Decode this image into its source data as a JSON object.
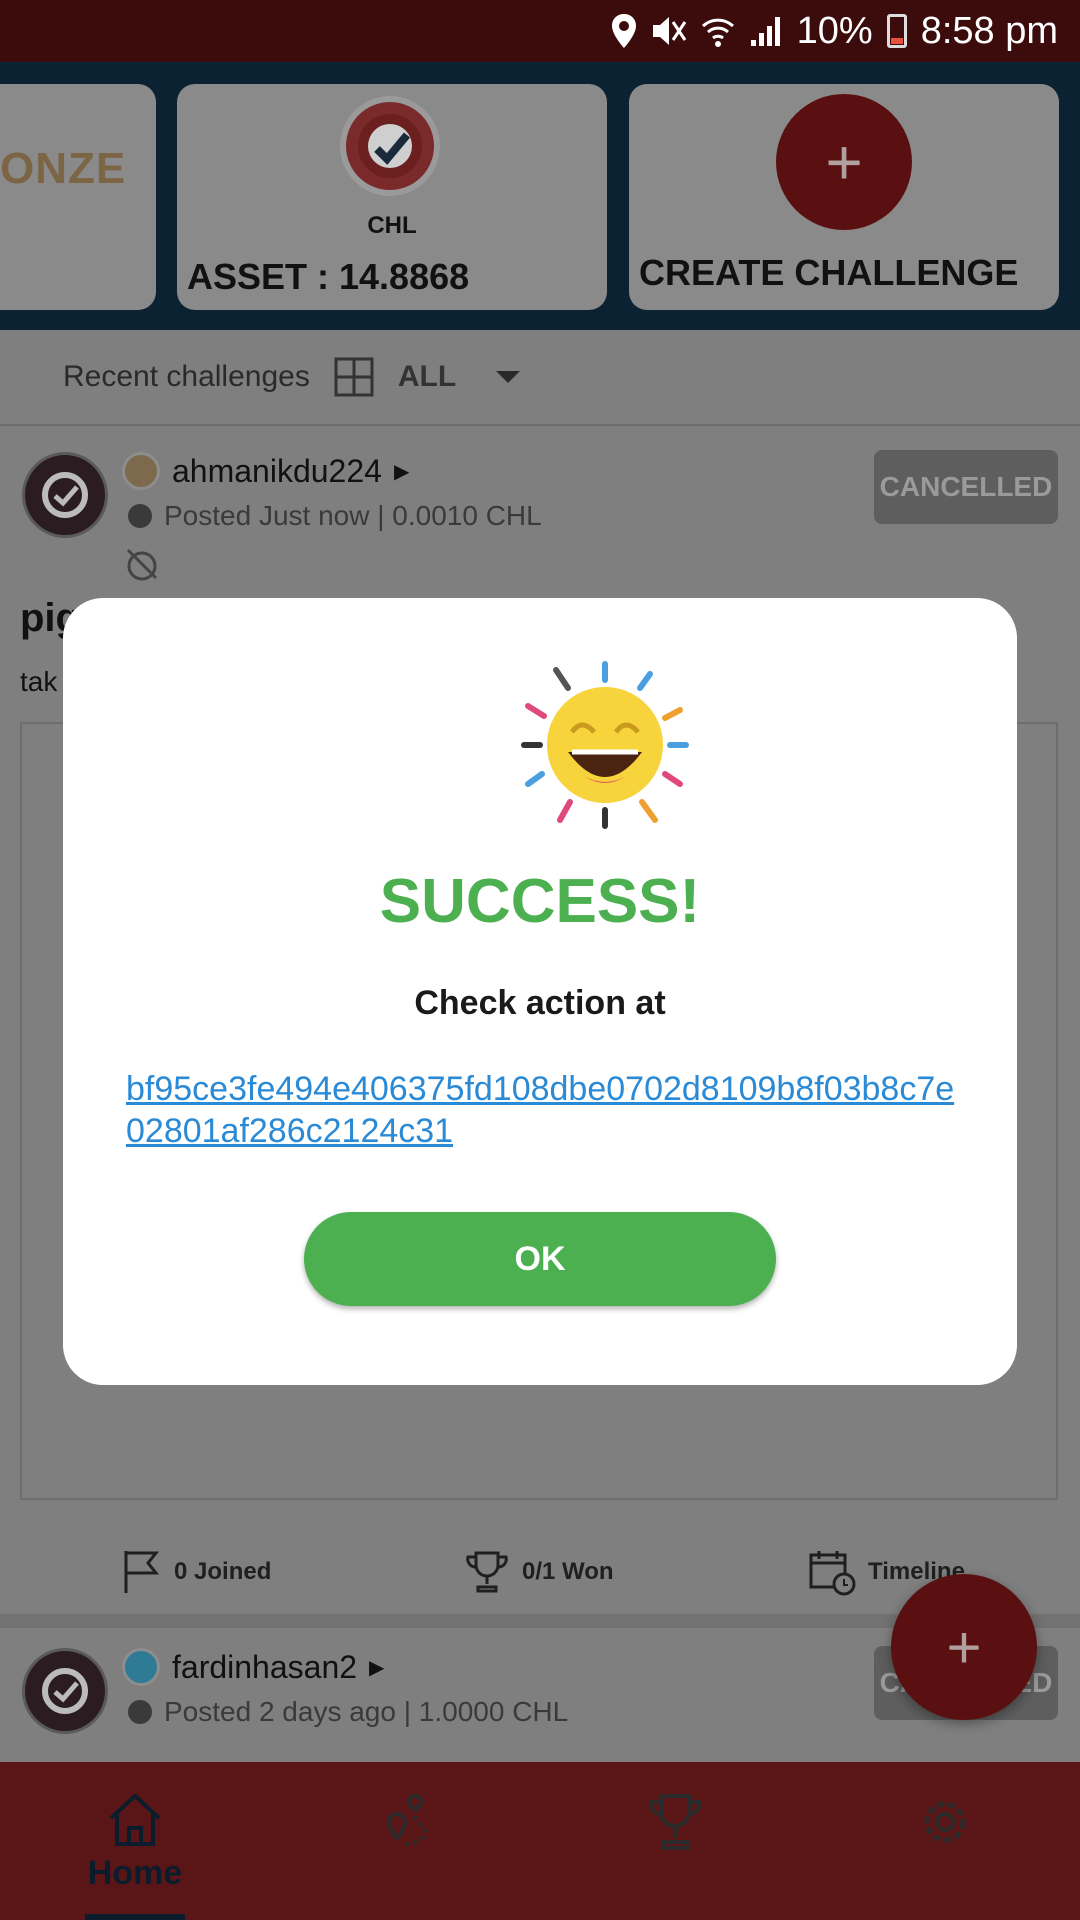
{
  "status_bar": {
    "battery": "10%",
    "time": "8:58 pm"
  },
  "header": {
    "bronze_card": {
      "label": "ONZE"
    },
    "chl_card": {
      "code": "CHL",
      "asset": "ASSET : 14.8868"
    },
    "create_card": {
      "plus": "+",
      "label": "CREATE CHALLENGE"
    }
  },
  "filter": {
    "label": "Recent challenges",
    "value": "ALL"
  },
  "posts": [
    {
      "username": "ahmanikdu224",
      "meta": "Posted Just now | 0.0010 CHL",
      "status": "CANCELLED",
      "title": "pig",
      "description": "tak",
      "joined": "0 Joined",
      "won": "0/1 Won",
      "timeline": "Timeline"
    },
    {
      "username": "fardinhasan2",
      "meta": "Posted 2 days ago | 1.0000 CHL",
      "status": "CANCELLED"
    }
  ],
  "fab": {
    "plus": "+"
  },
  "nav": {
    "home": "Home"
  },
  "dialog": {
    "title": "SUCCESS!",
    "check_label": "Check action at",
    "hash": "bf95ce3fe494e406375fd108dbe0702d8109b8f03b8c7e02801af286c2124c31",
    "ok": "OK"
  },
  "colors": {
    "success_green": "#4caf50",
    "link_blue": "#2a8ad6",
    "brand_maroon": "#7a1a1a"
  }
}
